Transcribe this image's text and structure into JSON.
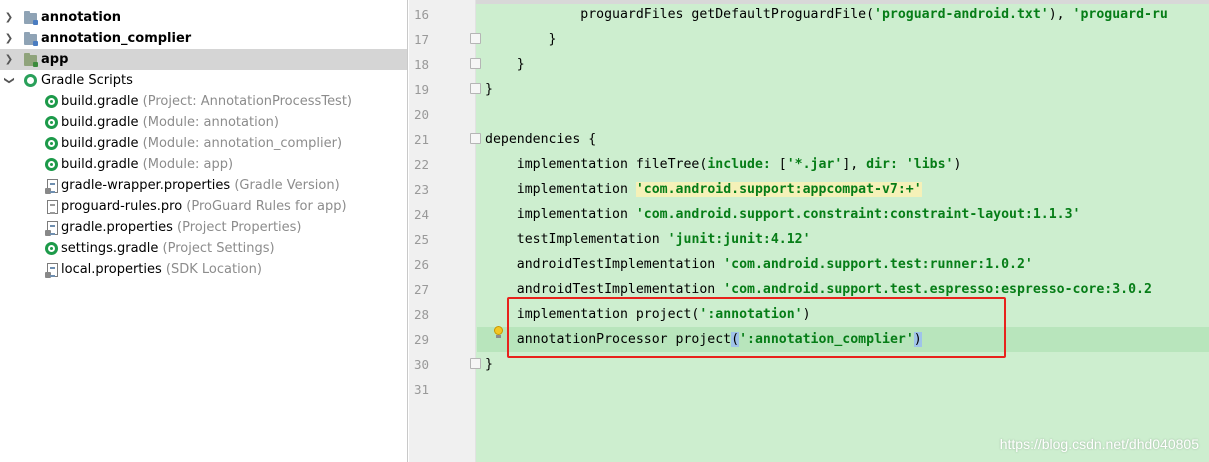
{
  "project_tree": {
    "items": [
      {
        "name": "annotation",
        "hint": "",
        "icon": "module-folder-icon",
        "bold": true
      },
      {
        "name": "annotation_complier",
        "hint": "",
        "icon": "module-folder-icon",
        "bold": true
      },
      {
        "name": "app",
        "hint": "",
        "icon": "app-module-folder-icon",
        "bold": true
      },
      {
        "name": "Gradle Scripts",
        "hint": "",
        "icon": "gradle-scripts-icon",
        "bold": false
      },
      {
        "name": "build.gradle",
        "hint": " (Project: AnnotationProcessTest)",
        "icon": "gradle-file-icon"
      },
      {
        "name": "build.gradle",
        "hint": " (Module: annotation)",
        "icon": "gradle-file-icon"
      },
      {
        "name": "build.gradle",
        "hint": " (Module: annotation_complier)",
        "icon": "gradle-file-icon"
      },
      {
        "name": "build.gradle",
        "hint": " (Module: app)",
        "icon": "gradle-file-icon"
      },
      {
        "name": "gradle-wrapper.properties",
        "hint": " (Gradle Version)",
        "icon": "properties-file-icon"
      },
      {
        "name": "proguard-rules.pro",
        "hint": " (ProGuard Rules for app)",
        "icon": "proguard-file-icon"
      },
      {
        "name": "gradle.properties",
        "hint": " (Project Properties)",
        "icon": "properties-file-icon"
      },
      {
        "name": "settings.gradle",
        "hint": " (Project Settings)",
        "icon": "gradle-file-icon"
      },
      {
        "name": "local.properties",
        "hint": " (SDK Location)",
        "icon": "properties-file-icon"
      }
    ]
  },
  "editor": {
    "line_numbers": [
      "16",
      "17",
      "18",
      "19",
      "20",
      "21",
      "22",
      "23",
      "24",
      "25",
      "26",
      "27",
      "28",
      "29",
      "30",
      "31"
    ],
    "lines": {
      "l16": {
        "prefix": "            proguardFiles getDefaultProguardFile(",
        "str1": "'proguard-android.txt'",
        "mid": "), ",
        "str2": "'proguard-ru"
      },
      "l17": "        }",
      "l18": "    }",
      "l19": "}",
      "l21": "dependencies {",
      "l22": {
        "a": "    implementation fileTree(",
        "k1": "include: ",
        "b": "[",
        "s1": "'*.jar'",
        "c": "], ",
        "k2": "dir: ",
        "s2": "'libs'",
        "d": ")"
      },
      "l23": {
        "a": "    implementation ",
        "s": "'com.android.support:appcompat-v7:+'"
      },
      "l24": {
        "a": "    implementation ",
        "s": "'com.android.support.constraint:constraint-layout:1.1.3'"
      },
      "l25": {
        "a": "    testImplementation ",
        "s": "'junit:junit:4.12'"
      },
      "l26": {
        "a": "    androidTestImplementation ",
        "s": "'com.android.support.test:runner:1.0.2'"
      },
      "l27": {
        "a": "    androidTestImplementation ",
        "s": "'com.android.support.test.espresso:espresso-core:3.0.2"
      },
      "l28": {
        "a": "    implementation project(",
        "s": "':annotation'",
        "b": ")"
      },
      "l29": {
        "a": "    annotationProcessor project",
        "p1": "(",
        "s": "':annotation_complier'",
        "p2": ")"
      },
      "l30": "}"
    }
  },
  "watermark": "https://blog.csdn.net/dhd040805",
  "colors": {
    "editor_bg": "#cdeecf",
    "string": "#067d17",
    "highlight_box": "#e8221c",
    "selection_row": "#d5d5d5"
  }
}
